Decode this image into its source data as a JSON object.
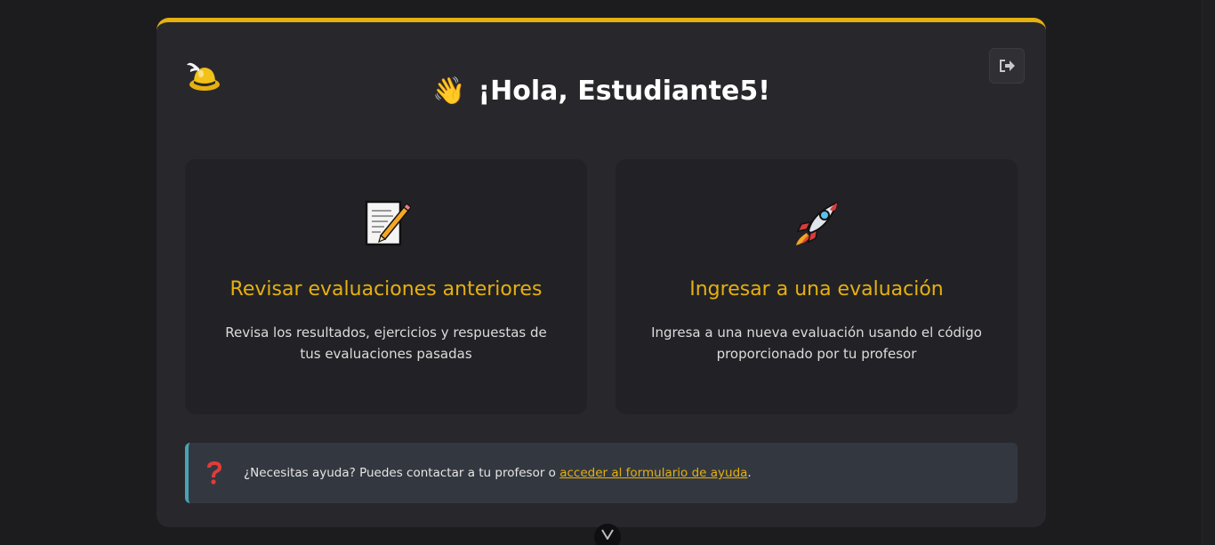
{
  "header": {
    "greeting": "¡Hola, Estudiante5!",
    "wave_emoji": "👋",
    "logo_icon": "winged-hat-icon",
    "logout_icon": "sign-out-icon"
  },
  "cards": [
    {
      "icon": "memo-icon",
      "title": "Revisar evaluaciones anteriores",
      "description": "Revisa los resultados, ejercicios y respuestas de tus evaluaciones pasadas"
    },
    {
      "icon": "rocket-icon",
      "title": "Ingresar a una evaluación",
      "description": "Ingresa a una nueva evaluación usando el código proporcionado por tu profesor"
    }
  ],
  "help": {
    "icon": "question-mark-icon",
    "text": "¿Necesitas ayuda? Puedes contactar a tu profesor o ",
    "link": "acceder al formulario de ayuda",
    "suffix": "."
  },
  "colors": {
    "accent": "#e6b00f",
    "help_border": "#4aa3b4",
    "card_bg": "#28282c",
    "page_bg": "#1c1c1f"
  }
}
